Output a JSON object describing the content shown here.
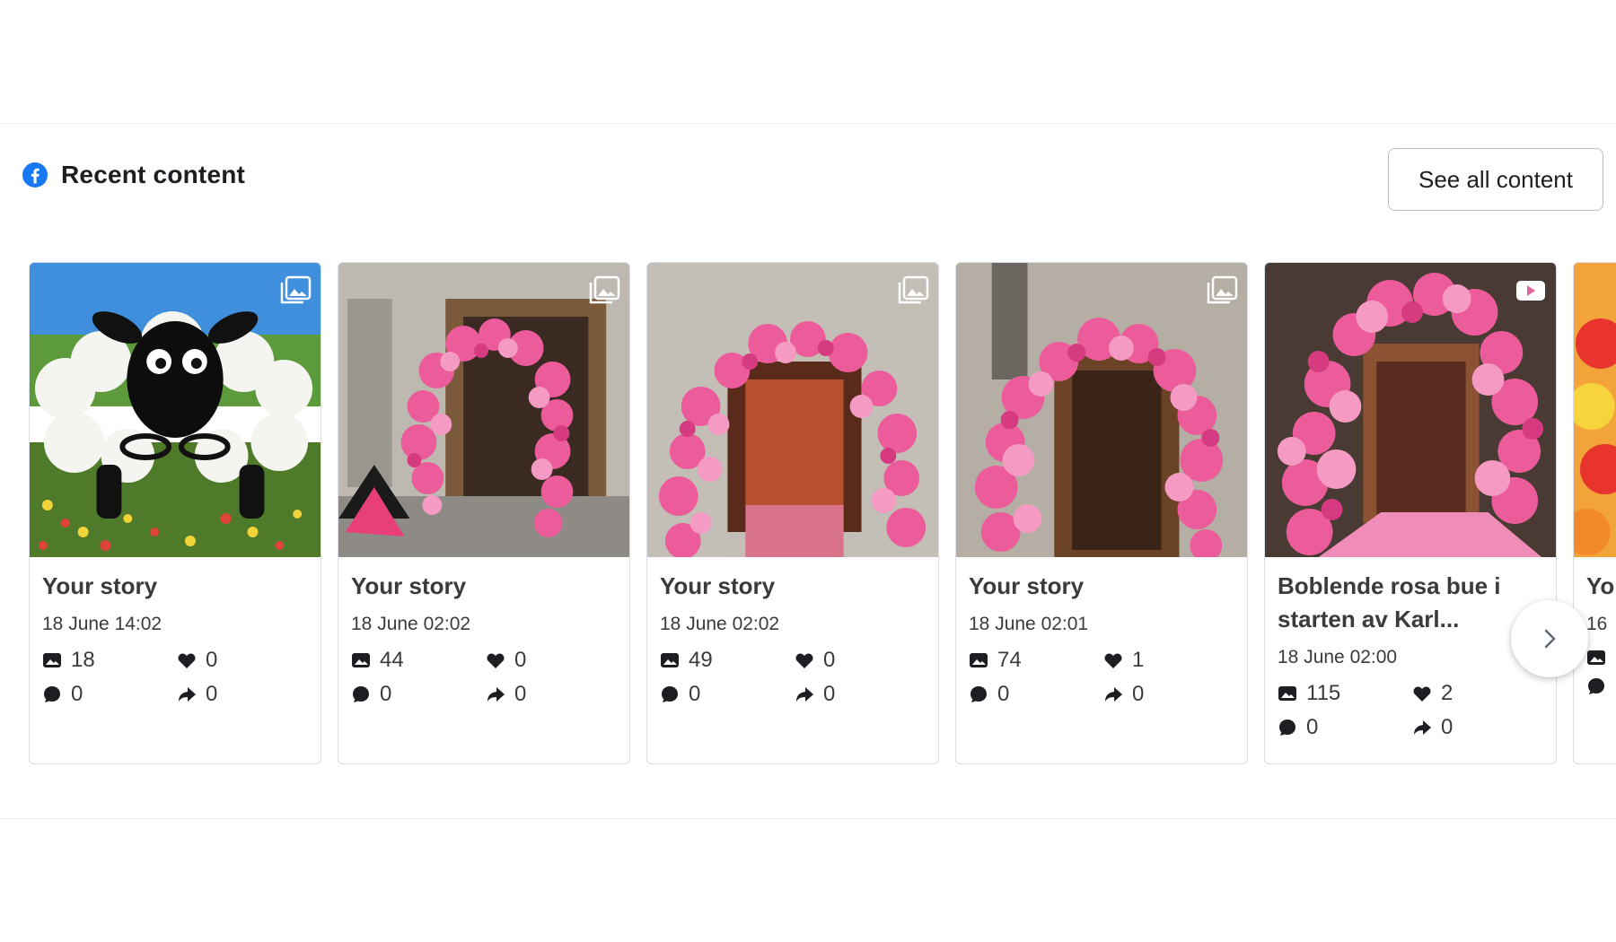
{
  "section": {
    "title": "Recent content",
    "see_all_label": "See all content"
  },
  "cards": [
    {
      "title": "Your story",
      "date": "18 June 14:02",
      "reach": "18",
      "likes": "0",
      "comments": "0",
      "shares": "0",
      "type_icon": "photo-stack-icon",
      "image": "white balloon sheep on flower field"
    },
    {
      "title": "Your story",
      "date": "18 June 02:02",
      "reach": "44",
      "likes": "0",
      "comments": "0",
      "shares": "0",
      "type_icon": "photo-stack-icon",
      "image": "pink balloon arch at shop entrance"
    },
    {
      "title": "Your story",
      "date": "18 June 02:02",
      "reach": "49",
      "likes": "0",
      "comments": "0",
      "shares": "0",
      "type_icon": "photo-stack-icon",
      "image": "pink balloon arch at shop entrance"
    },
    {
      "title": "Your story",
      "date": "18 June 02:01",
      "reach": "74",
      "likes": "1",
      "comments": "0",
      "shares": "0",
      "type_icon": "photo-stack-icon",
      "image": "pink balloon arch at shop entrance"
    },
    {
      "title": "Boblende rosa bue i starten av Karl...",
      "date": "18 June 02:00",
      "reach": "115",
      "likes": "2",
      "comments": "0",
      "shares": "0",
      "type_icon": "video-icon",
      "image": "pink balloon arch close-up"
    }
  ],
  "partial_card": {
    "title": "Yo",
    "date": "16"
  },
  "colors": {
    "facebook_blue": "#1877f2",
    "text": "#3a3b3c",
    "border": "#dadde1",
    "balloon_pink": "#ec5c9a"
  }
}
